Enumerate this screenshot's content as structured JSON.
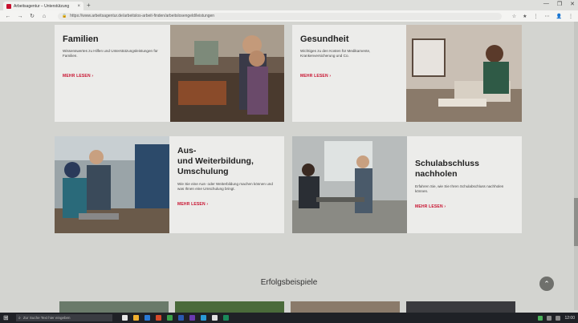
{
  "browser": {
    "tab_title": "Arbeitsagentur – Unterstützung",
    "tab_close": "×",
    "new_tab": "+",
    "url": "https://www.arbeitsagentur.de/arbeitslos-arbeit-finden/arbeitslosengeld/leistungen",
    "back": "←",
    "forward": "→",
    "reload": "↻",
    "home": "⌂",
    "window_controls": [
      "—",
      "❐",
      "✕"
    ],
    "right_icons": [
      "☆",
      "★",
      "⋮",
      "⋯",
      "👤",
      "⋮"
    ]
  },
  "cards": {
    "familien": {
      "title": "Familien",
      "text": "Wissenswertes zu Hilfen und Unterstützungsleistungen für Familien.",
      "more": "MEHR LESEN"
    },
    "gesundheit": {
      "title": "Gesundheit",
      "text": "Wichtiges zu den Kosten für Medikamente, Krankenversicherung und Co.",
      "more": "MEHR LESEN"
    },
    "weiterbildung": {
      "title": "Aus- und Weiterbildung, Umschulung",
      "title_lines": [
        "Aus-",
        "und Weiterbildung,",
        "Umschulung"
      ],
      "text": "Wie Sie eine Aus- oder Weiterbildung machen können und was Ihnen eine Umschulung bringt.",
      "more": "MEHR LESEN"
    },
    "schulabschluss": {
      "title": "Schulabschluss nachholen",
      "title_lines": [
        "Schulabschluss",
        "nachholen"
      ],
      "text": "Erfahren Sie, wie Sie Ihren Schulabschluss nachholen können.",
      "more": "MEHR LESEN"
    }
  },
  "more_arrow": "›",
  "section": {
    "title": "Erfolgsbeispiele"
  },
  "scroll_top": "⌃",
  "taskbar": {
    "start": "⊞",
    "search_placeholder": "Zur Suche Text hier eingeben",
    "search_icon": "⌕",
    "tray_time": "12:00"
  }
}
